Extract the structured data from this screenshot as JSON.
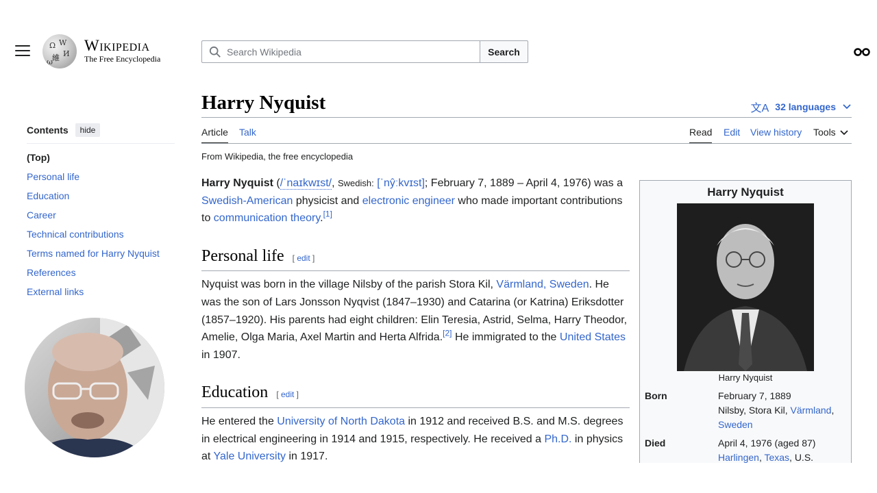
{
  "header": {
    "wordmark": "Wikipedia",
    "tagline": "The Free Encyclopedia",
    "search_placeholder": "Search Wikipedia",
    "search_button": "Search"
  },
  "toc": {
    "title": "Contents",
    "hide_label": "hide",
    "items": [
      {
        "label": "(Top)"
      },
      {
        "label": "Personal life"
      },
      {
        "label": "Education"
      },
      {
        "label": "Career"
      },
      {
        "label": "Technical contributions"
      },
      {
        "label": "Terms named for Harry Nyquist"
      },
      {
        "label": "References"
      },
      {
        "label": "External links"
      }
    ]
  },
  "article": {
    "title": "Harry Nyquist",
    "languages": "32 languages",
    "tabs": {
      "article": "Article",
      "talk": "Talk",
      "read": "Read",
      "edit": "Edit",
      "history": "View history",
      "tools": "Tools"
    },
    "from": "From Wikipedia, the free encyclopedia",
    "intro": {
      "name": "Harry Nyquist",
      "p1": " (",
      "ipa": "/ˈnaɪkwɪst/",
      "p2": ", ",
      "swedish_label": "Swedish:",
      "p3": " ",
      "ipa_sv": "[ˈnŷːkvɪst]",
      "p4": "; February 7, 1889 – April 4, 1976) was a ",
      "link1": "Swedish-American",
      "p5": " physicist and ",
      "link2": "electronic engineer",
      "p6": " who made important contributions to ",
      "link3": "communication theory",
      "p7": ".",
      "ref": "[1]"
    },
    "personal_life": {
      "heading": "Personal life",
      "edit": "edit",
      "t1": "Nyquist was born in the village Nilsby of the parish Stora Kil, ",
      "link1": "Värmland, Sweden",
      "t2": ". He was the son of Lars Jonsson Nyqvist (1847–1930) and Catarina (or Katrina) Eriksdotter (1857–1920). His parents had eight children: Elin Teresia, Astrid, Selma, Harry Theodor, Amelie, Olga Maria, Axel Martin and Herta Alfrida.",
      "ref": "[2]",
      "t3": " He immigrated to the ",
      "link2": "United States",
      "t4": " in 1907."
    },
    "education": {
      "heading": "Education",
      "edit": "edit",
      "t1": "He entered the ",
      "link1": "University of North Dakota",
      "t2": " in 1912 and received B.S. and M.S. degrees in electrical engineering in 1914 and 1915, respectively. He received a ",
      "link2": "Ph.D.",
      "t3": " in physics at ",
      "link3": "Yale University",
      "t4": " in 1917."
    }
  },
  "infobox": {
    "title": "Harry Nyquist",
    "caption": "Harry Nyquist",
    "born_label": "Born",
    "born_date": "February 7, 1889",
    "born_place": "Nilsby, Stora Kil, ",
    "born_link1": "Värmland",
    "born_sep": ", ",
    "born_link2": "Sweden",
    "died_label": "Died",
    "died_date": "April 4, 1976 (aged 87)",
    "died_link1": "Harlingen",
    "died_sep": ", ",
    "died_link2": "Texas",
    "died_country": ", U.S."
  }
}
